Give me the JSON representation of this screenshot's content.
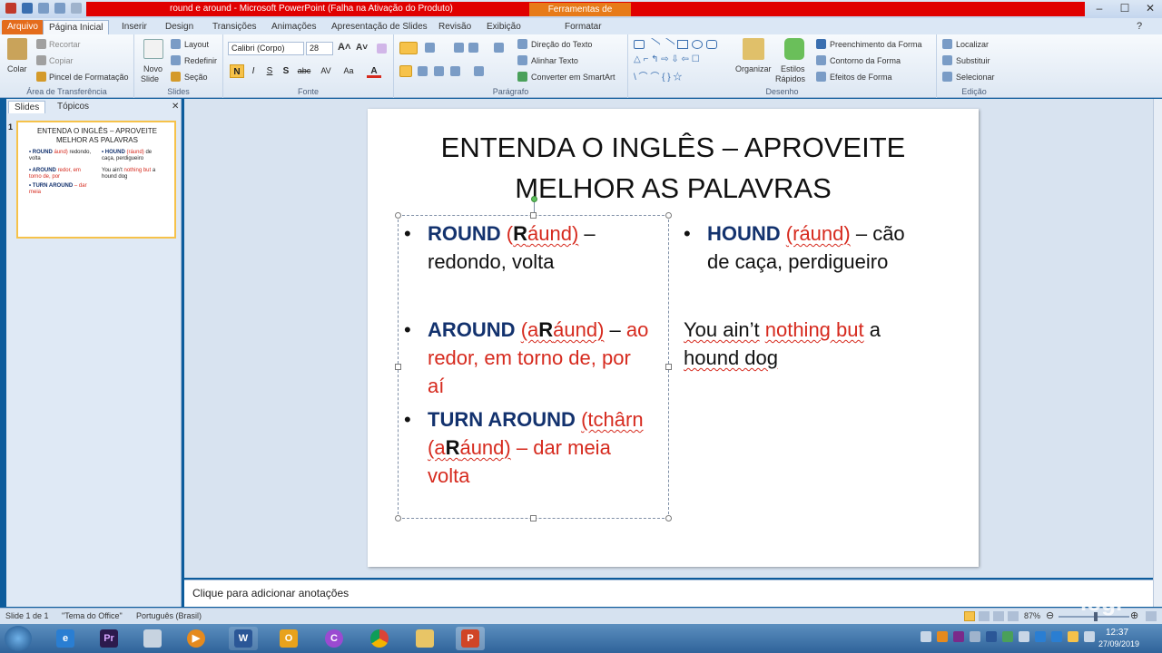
{
  "window": {
    "title": "round e around  -  Microsoft PowerPoint (Falha na Ativação do Produto)",
    "context_tab": "Ferramentas de Desenho",
    "format_tab": "Formatar"
  },
  "tabs": [
    "Arquivo",
    "Página Inicial",
    "Inserir",
    "Design",
    "Transições",
    "Animações",
    "Apresentação de Slides",
    "Revisão",
    "Exibição"
  ],
  "ribbon": {
    "clipboard": {
      "paste": "Colar",
      "cut": "Recortar",
      "copy": "Copiar",
      "painter": "Pincel de Formatação",
      "label": "Área de Transferência"
    },
    "slides": {
      "new": "Novo",
      "new2": "Slide",
      "layout": "Layout",
      "reset": "Redefinir",
      "section": "Seção",
      "label": "Slides"
    },
    "font": {
      "name": "Calibri (Corpo)",
      "size": "28",
      "bold": "N",
      "italic": "I",
      "underline": "S",
      "shadow": "S",
      "strike": "abc",
      "spacing": "AV",
      "case": "Aa",
      "label": "Fonte"
    },
    "paragraph": {
      "text_direction": "Direção do Texto",
      "align_text": "Alinhar Texto",
      "smartart": "Converter em SmartArt",
      "label": "Parágrafo"
    },
    "drawing": {
      "arrange": "Organizar",
      "styles": "Estilos",
      "styles2": "Rápidos",
      "fill": "Preenchimento da Forma",
      "outline": "Contorno da Forma",
      "effects": "Efeitos de Forma",
      "label": "Desenho"
    },
    "editing": {
      "find": "Localizar",
      "replace": "Substituir",
      "select": "Selecionar",
      "label": "Edição"
    }
  },
  "left_panel": {
    "tabs": [
      "Slides",
      "Tópicos"
    ],
    "slide_number": "1",
    "thumb_title": "ENTENDA O INGLÊS – APROVEITE MELHOR AS PALAVRAS"
  },
  "slide": {
    "title_line1": "ENTENDA O INGLÊS – APROVEITE",
    "title_line2": "MELHOR AS PALAVRAS",
    "left": {
      "b1_word": "ROUND",
      "b1_pron_open": "(",
      "b1_pron_R": "R",
      "b1_pron_rest": "áund)",
      "b1_dash": "–",
      "b1_meaning": "redondo, volta",
      "b2_word": "AROUND",
      "b2_pron_a": "(a",
      "b2_pron_R": "R",
      "b2_pron_rest": "áund)",
      "b2_dash": "–",
      "b2_meaning_1": "ao",
      "b2_meaning_2": "redor, em torno de, por",
      "b2_meaning_3": "aí",
      "b3_word": "TURN AROUND",
      "b3_pron1": "(tchârn",
      "b3_pron2_a": "(a",
      "b3_pron2_R": "R",
      "b3_pron2_rest": "áund)",
      "b3_meaning": "– dar meia",
      "b3_meaning_2": "volta"
    },
    "right": {
      "b1_word": "HOUND",
      "b1_pron": "(ráund)",
      "b1_meaning_1": "– cão",
      "b1_meaning_2": "de caça, perdigueiro",
      "quote_1a": "You ain’t",
      "quote_1b": "nothing but",
      "quote_1c": "a",
      "quote_2": "hound dog"
    }
  },
  "notes": "Clique para adicionar anotações",
  "status": {
    "slide": "Slide 1 de 1",
    "theme": "\"Tema do Office\"",
    "language": "Português (Brasil)",
    "zoom": "87%"
  },
  "taskbar": {
    "time": "12:37",
    "date": "27/09/2019",
    "watermark": "logi"
  },
  "colors": {
    "navy": "#13326e",
    "red": "#d62a1e",
    "file_tab": "#e46c1c"
  }
}
